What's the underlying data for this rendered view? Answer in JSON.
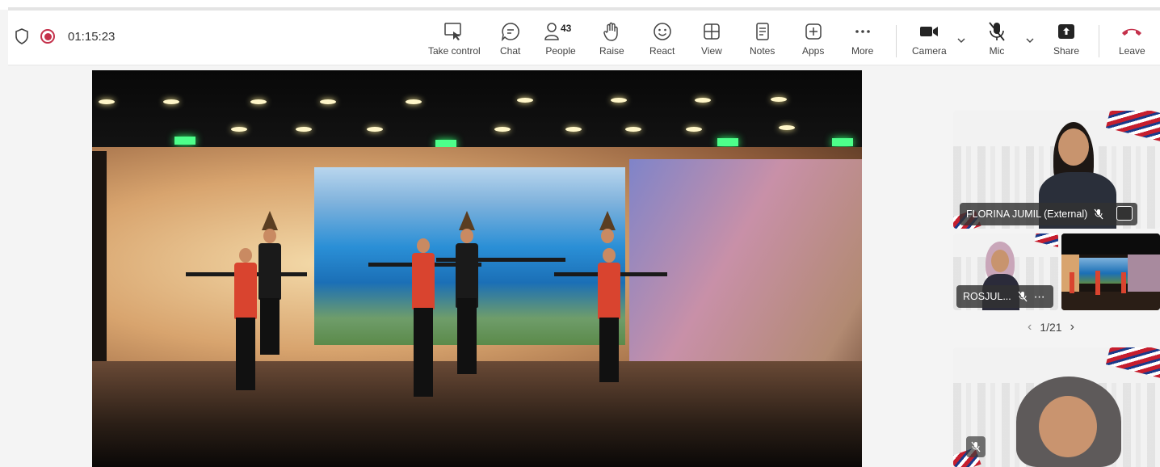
{
  "meeting": {
    "timer": "01:15:23",
    "icons": {
      "security": "shield-icon",
      "recording": "record-icon"
    },
    "recording_color": "#c4314b"
  },
  "toolbar": {
    "take_control": "Take control",
    "chat": "Chat",
    "people": "People",
    "people_count": "43",
    "raise": "Raise",
    "react": "React",
    "view": "View",
    "notes": "Notes",
    "apps": "Apps",
    "more": "More",
    "camera": "Camera",
    "mic": "Mic",
    "share": "Share",
    "leave": "Leave",
    "leave_color": "#c4314b"
  },
  "participants": {
    "tile1_name": "FLORINA JUMIL (External)",
    "tile2_name": "ROSJUL...",
    "page_indicator": "1/21"
  }
}
